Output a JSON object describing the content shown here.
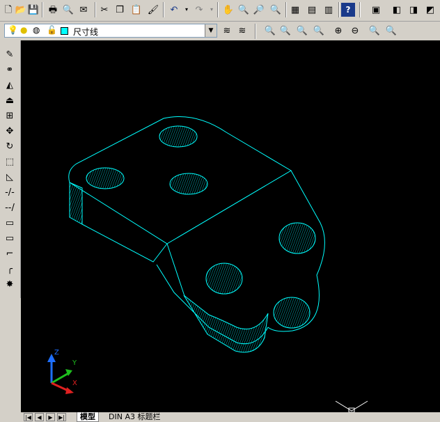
{
  "layer": {
    "name": "尺寸线"
  },
  "colors": {
    "model_line": "#00ffff",
    "background": "#000000",
    "toolbar": "#d4d0c8"
  },
  "ucs": {
    "x": "X",
    "y": "Y",
    "z": "Z"
  },
  "tabs": [
    {
      "label": "模型"
    },
    {
      "label": "DIN A3 标题栏"
    }
  ],
  "icons": {
    "top": [
      "new-file-icon",
      "open-file-icon",
      "save-icon",
      "print-icon",
      "print-preview-icon",
      "publish-icon",
      "cut-icon",
      "copy-icon",
      "paste-icon",
      "match-properties-icon",
      "undo-icon",
      "redo-icon",
      "pan-icon",
      "zoom-realtime-icon",
      "zoom-window-icon",
      "zoom-previous-icon",
      "properties-icon",
      "design-center-icon",
      "tool-palettes-icon",
      "help-icon",
      "view-icon",
      "box-icon",
      "cylinder-icon",
      "cone-icon"
    ],
    "left": [
      "line-icon",
      "polyline-icon",
      "mirror-icon",
      "offset-icon",
      "array-icon",
      "move-icon",
      "rotate-icon",
      "scale-icon",
      "stretch-icon",
      "trim-icon",
      "extend-icon",
      "break-icon",
      "chamfer-icon",
      "fillet-icon",
      "explode-icon"
    ]
  }
}
